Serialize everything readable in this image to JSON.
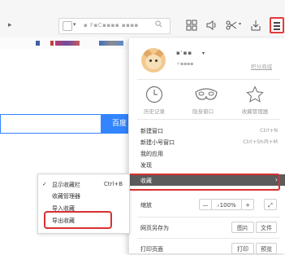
{
  "address_bar": {
    "url_text": "▪ F▪C▪▪▪▪ ▪▪▪▪",
    "search_icon": "search-icon"
  },
  "menu": {
    "user": {
      "name": "▪'▪▪",
      "sub": "+▪▪▪▪",
      "points_link": "积分商城"
    },
    "quick": [
      {
        "label": "历史记录",
        "icon": "clock-icon"
      },
      {
        "label": "隐身窗口",
        "icon": "mask-icon"
      },
      {
        "label": "收藏管理器",
        "icon": "star-icon"
      }
    ],
    "items": [
      {
        "label": "新建窗口",
        "shortcut": "Ctrl+N"
      },
      {
        "label": "新建小号窗口",
        "shortcut": "Ctrl+Shift+M"
      },
      {
        "label": "我的应用",
        "shortcut": ""
      },
      {
        "label": "发现",
        "shortcut": ""
      }
    ],
    "favorites": {
      "label": "收藏",
      "chevron": "›"
    },
    "zoom": {
      "label": "缩放",
      "minus": "—",
      "value": "100%",
      "plus": "+",
      "fullscreen": "⤢"
    },
    "save_as": {
      "label": "网页另存为",
      "btn_image": "图片",
      "btn_file": "文件"
    },
    "print": {
      "label": "打印页面",
      "btn_print": "打印",
      "btn_preview": "预览"
    }
  },
  "submenu": {
    "items": [
      {
        "checked": true,
        "label": "显示收藏栏",
        "shortcut": "Ctrl+B"
      },
      {
        "checked": false,
        "label": "收藏管理器",
        "shortcut": ""
      },
      {
        "checked": false,
        "label": "导入收藏",
        "shortcut": ""
      },
      {
        "checked": false,
        "label": "导出收藏",
        "shortcut": ""
      }
    ]
  },
  "page": {
    "search_button": "百度"
  },
  "colors": {
    "highlight_outline": "#d93030",
    "favorites_row_bg": "#5b5b5b",
    "search_blue": "#3385ff"
  }
}
